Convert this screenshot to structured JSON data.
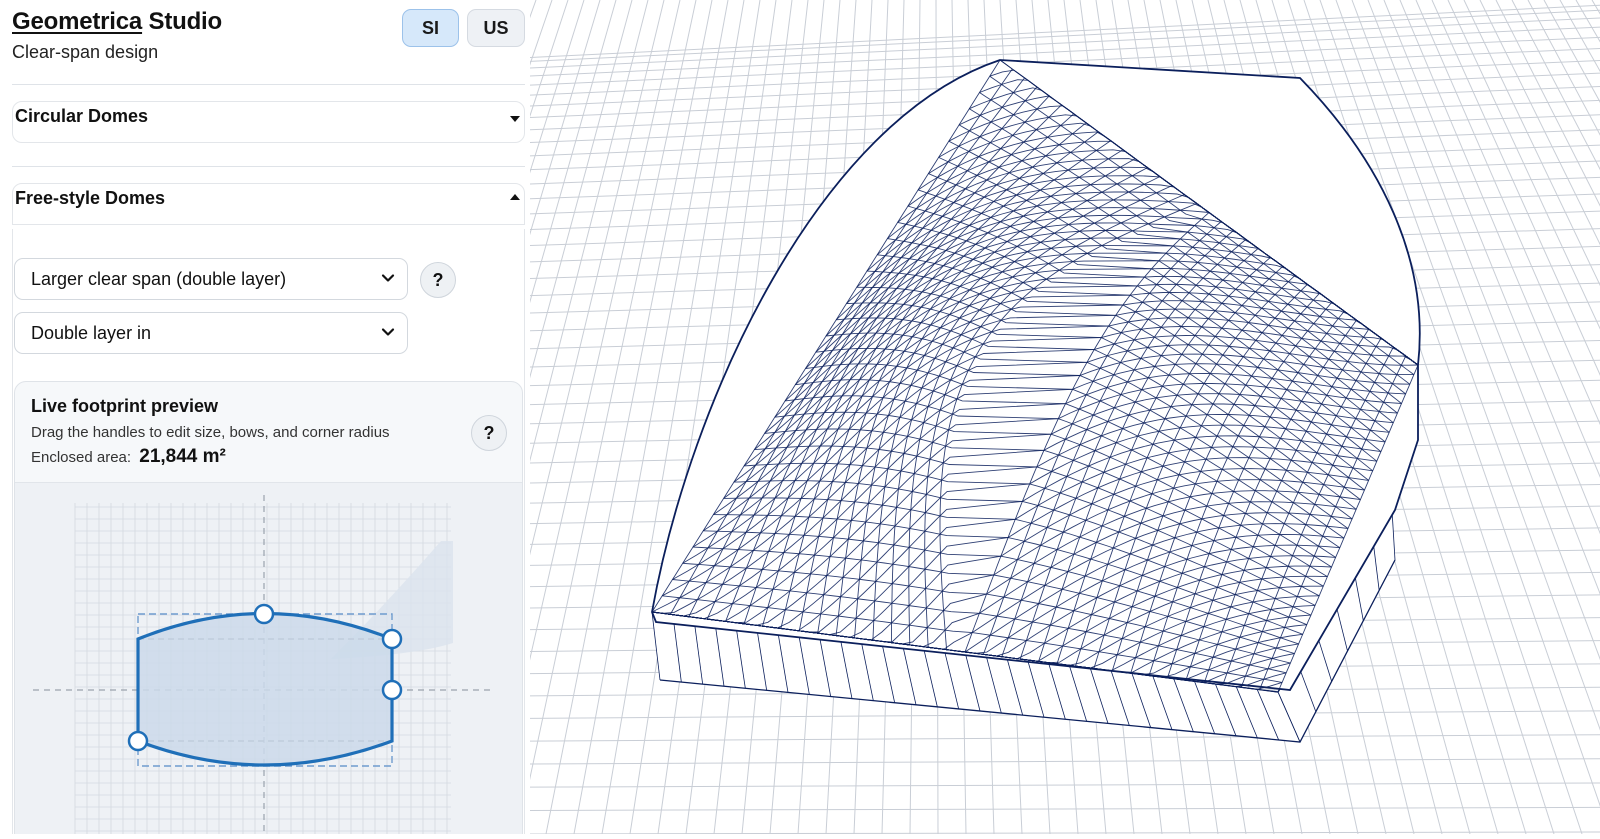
{
  "header": {
    "brand_name": "Geometrica",
    "brand_suffix": "Studio",
    "tagline": "Clear-span design"
  },
  "units": {
    "si_label": "SI",
    "us_label": "US",
    "active": "SI"
  },
  "sections": {
    "circular": {
      "label": "Circular Domes",
      "state": "collapsed"
    },
    "freestyle": {
      "label": "Free-style Domes",
      "state": "expanded"
    }
  },
  "freestyle": {
    "structure_select": "Larger clear span (double layer)",
    "layer_select": "Double layer in",
    "help_label": "?"
  },
  "preview": {
    "title": "Live footprint preview",
    "hint": "Drag the handles to edit size, bows, and corner radius",
    "area_label": "Enclosed area:",
    "area_value": "21,844 m²",
    "help_label": "?"
  },
  "colors": {
    "accent": "#1f6fb8",
    "si_active_bg": "#d6e8fa",
    "mesh": "#0b1f5c",
    "grid": "#c9ced6"
  },
  "icons": {
    "chevron": "chevron-down-icon",
    "caret_collapsed": "caret-down-icon",
    "caret_expanded": "caret-up-icon",
    "help": "question-icon"
  }
}
